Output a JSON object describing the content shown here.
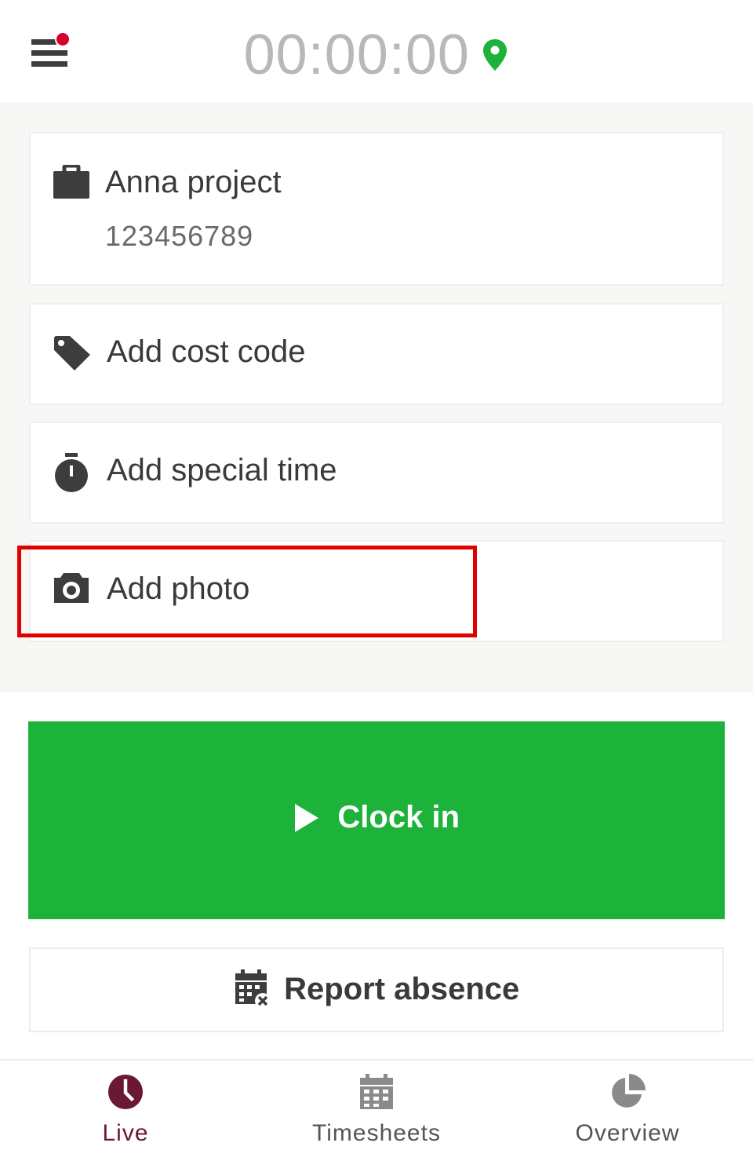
{
  "header": {
    "timer": "00:00:00",
    "menu_icon": "hamburger-menu-icon",
    "notification_dot_color": "#d5002b",
    "location_icon": "location-pin-icon",
    "location_color": "#1db239"
  },
  "project": {
    "icon": "briefcase-icon",
    "name": "Anna project",
    "number": "123456789"
  },
  "cost_code": {
    "icon": "tag-icon",
    "label": "Add cost code"
  },
  "special_time": {
    "icon": "stopwatch-icon",
    "label": "Add special time"
  },
  "photo": {
    "icon": "camera-icon",
    "label": "Add photo",
    "highlighted": true,
    "highlight_color": "#e00000"
  },
  "clock_in": {
    "icon": "play-icon",
    "label": "Clock in",
    "color": "#1db239"
  },
  "report_absence": {
    "icon": "calendar-x-icon",
    "label": "Report absence"
  },
  "bottom_nav": {
    "items": [
      {
        "icon": "clock-icon",
        "label": "Live",
        "active": true,
        "color": "#6a1836"
      },
      {
        "icon": "calendar-icon",
        "label": "Timesheets",
        "active": false
      },
      {
        "icon": "pie-chart-icon",
        "label": "Overview",
        "active": false
      }
    ]
  }
}
